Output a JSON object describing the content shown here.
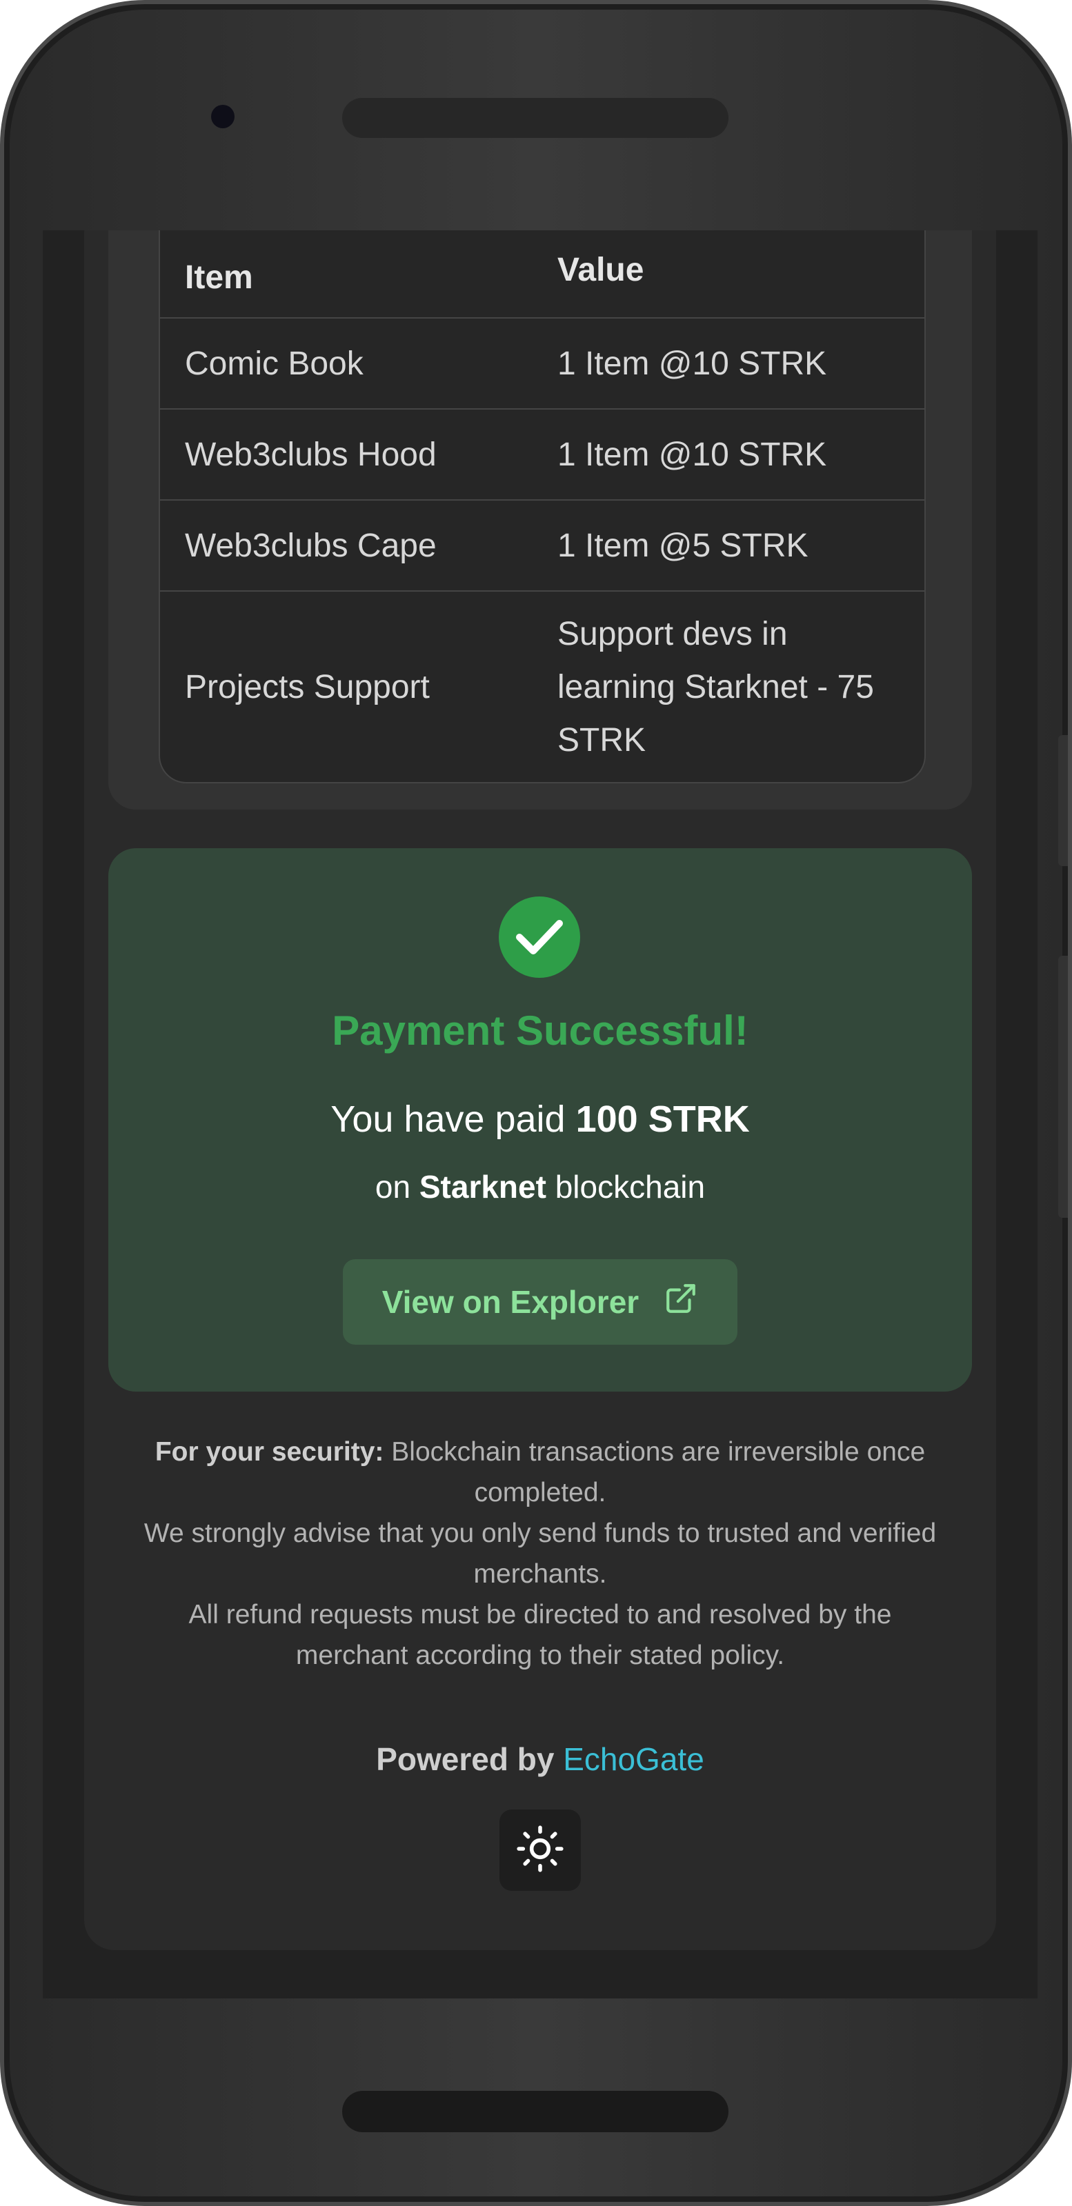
{
  "table": {
    "headers": {
      "item": "Item",
      "value": "Value"
    },
    "rows": [
      {
        "item": "Comic Book",
        "value": "1 Item @10 STRK"
      },
      {
        "item": "Web3clubs Hood",
        "value": "1 Item @10 STRK"
      },
      {
        "item": "Web3clubs Cape",
        "value": "1 Item @5 STRK"
      },
      {
        "item": "Projects Support",
        "value": "Support devs in learning Starknet - 75 STRK"
      }
    ]
  },
  "payment": {
    "title": "Payment Successful!",
    "paid_prefix": "You have paid",
    "amount": "100 STRK",
    "chain_prefix": "on",
    "chain": "Starknet",
    "chain_suffix": "blockchain",
    "explorer_label": "View on Explorer",
    "check_icon": "check-circle-icon",
    "external_icon": "external-link-icon"
  },
  "security": {
    "label": "For your security:",
    "line1": "Blockchain transactions are irreversible once completed.",
    "line2": "We strongly advise that you only send funds to trusted and verified merchants.",
    "line3": "All refund requests must be directed to and resolved by the merchant according to their stated policy."
  },
  "footer": {
    "powered_prefix": "Powered by",
    "brand": "EchoGate",
    "theme_icon": "sun-icon"
  },
  "colors": {
    "success_green": "#3aa855",
    "button_text": "#8de29b",
    "brand_link": "#3bbfd6"
  }
}
